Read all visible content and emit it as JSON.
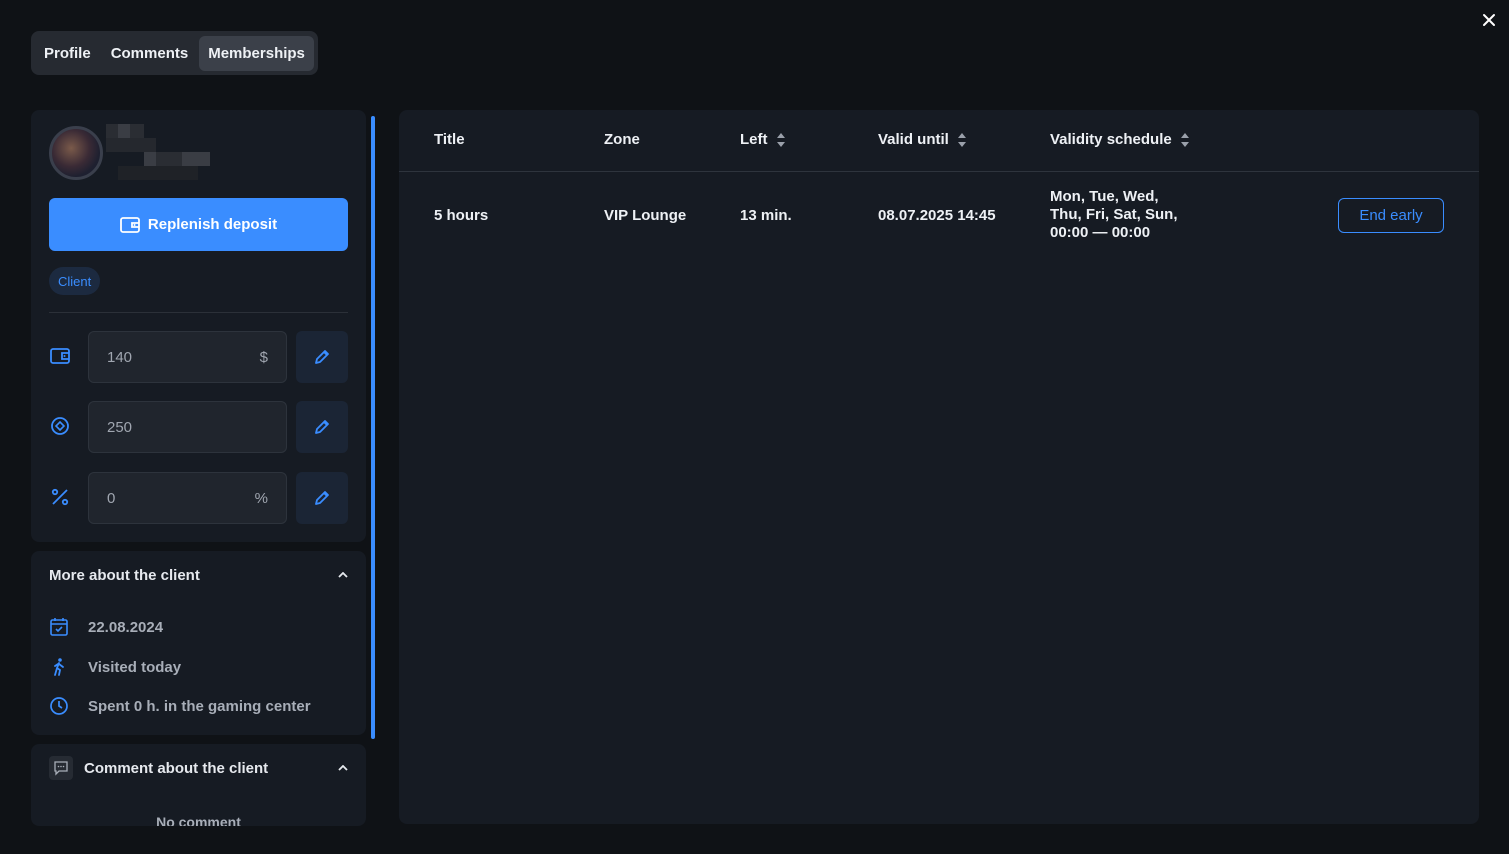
{
  "tabs": [
    {
      "label": "Profile"
    },
    {
      "label": "Comments"
    },
    {
      "label": "Memberships",
      "active": true
    }
  ],
  "client": {
    "replenish_label": "Replenish deposit",
    "badge": "Client",
    "deposit": {
      "value": "140",
      "unit": "$",
      "icon": "wallet-icon"
    },
    "bonus": {
      "value": "250",
      "unit": "",
      "icon": "bonus-coin-icon"
    },
    "discount": {
      "value": "0",
      "unit": "%",
      "icon": "percent-icon"
    }
  },
  "more": {
    "title": "More about the client",
    "registered": "22.08.2024",
    "visited": "Visited today",
    "spent": "Spent 0 h. in the gaming center"
  },
  "comment": {
    "title": "Comment about the client",
    "empty": "No comment"
  },
  "table": {
    "headers": {
      "title": "Title",
      "zone": "Zone",
      "left": "Left",
      "valid_until": "Valid until",
      "schedule": "Validity schedule"
    },
    "rows": [
      {
        "title": "5 hours",
        "zone": "VIP Lounge",
        "left": "13 min.",
        "valid_until": "08.07.2025 14:45",
        "schedule_line1": "Mon, Tue, Wed,",
        "schedule_line2": "Thu, Fri, Sat, Sun,",
        "schedule_line3": "00:00 — 00:00",
        "action": "End early"
      }
    ]
  },
  "colors": {
    "accent": "#3a8dff",
    "background": "#0f1216",
    "card": "#161b23"
  }
}
